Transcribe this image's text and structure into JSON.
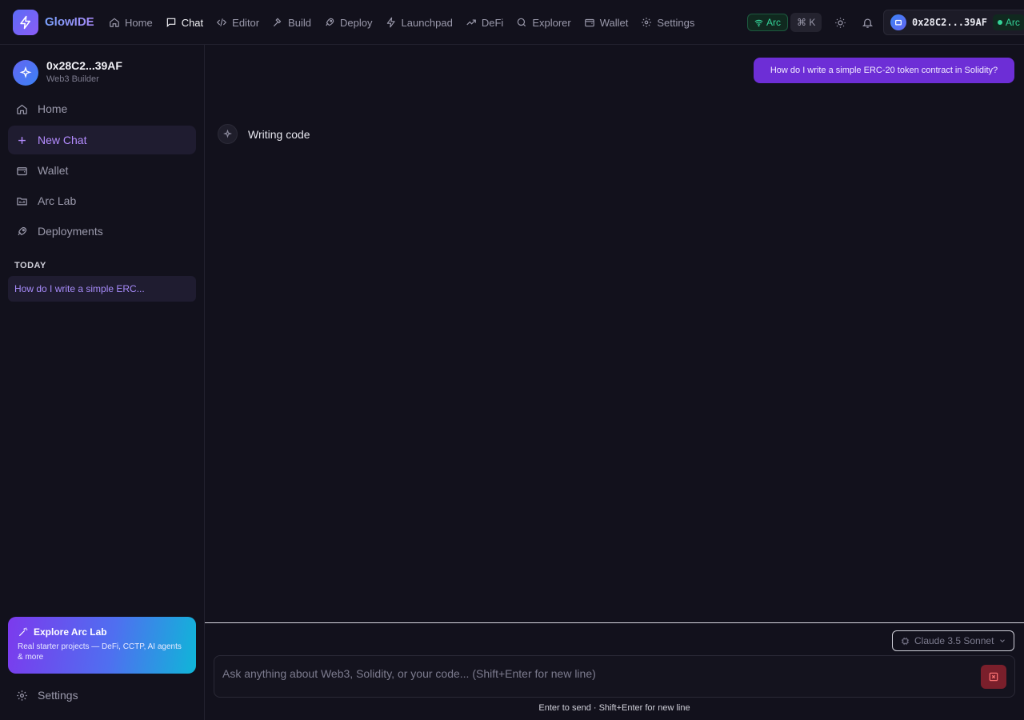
{
  "brand": {
    "name": "GlowIDE"
  },
  "nav": [
    {
      "label": "Home",
      "icon": "home-icon",
      "active": false
    },
    {
      "label": "Chat",
      "icon": "chat-icon",
      "active": true
    },
    {
      "label": "Editor",
      "icon": "code-icon",
      "active": false
    },
    {
      "label": "Build",
      "icon": "hammer-icon",
      "active": false
    },
    {
      "label": "Deploy",
      "icon": "rocket-icon",
      "active": false
    },
    {
      "label": "Launchpad",
      "icon": "bolt-icon",
      "active": false
    },
    {
      "label": "DeFi",
      "icon": "trending-up-icon",
      "active": false
    },
    {
      "label": "Explorer",
      "icon": "search-icon",
      "active": false
    },
    {
      "label": "Wallet",
      "icon": "wallet-icon",
      "active": false
    },
    {
      "label": "Settings",
      "icon": "gear-icon",
      "active": false
    }
  ],
  "topbar": {
    "network_label": "Arc",
    "shortcut_label": "⌘ K",
    "wallet_address": "0x28C2...39AF",
    "wallet_network": "Arc"
  },
  "sidebar": {
    "profile_name": "0x28C2...39AF",
    "profile_role": "Web3 Builder",
    "items": [
      {
        "label": "Home",
        "icon": "home-icon",
        "active": false
      },
      {
        "label": "New Chat",
        "icon": "plus-icon",
        "active": true
      },
      {
        "label": "Wallet",
        "icon": "wallet-icon",
        "active": false
      },
      {
        "label": "Arc Lab",
        "icon": "folder-icon",
        "active": false
      },
      {
        "label": "Deployments",
        "icon": "rocket-icon",
        "active": false
      }
    ],
    "section_today": "TODAY",
    "history": [
      "How do I write a simple ERC..."
    ],
    "explore_title": "Explore Arc Lab",
    "explore_desc": "Real starter projects — DeFi, CCTP, AI agents & more",
    "settings_label": "Settings"
  },
  "chat": {
    "user_message": "How do I write a simple ERC-20 token contract in Solidity?",
    "status_text": "Writing code"
  },
  "composer": {
    "model": "Claude 3.5 Sonnet",
    "placeholder": "Ask anything about Web3, Solidity, or your code... (Shift+Enter for new line)",
    "hint": "Enter to send · Shift+Enter for new line"
  },
  "colors": {
    "background": "#12111c",
    "accent": "#6d2ed6",
    "accent_text": "#a78bfa",
    "success": "#34d399",
    "stop": "#7a1f2b"
  }
}
